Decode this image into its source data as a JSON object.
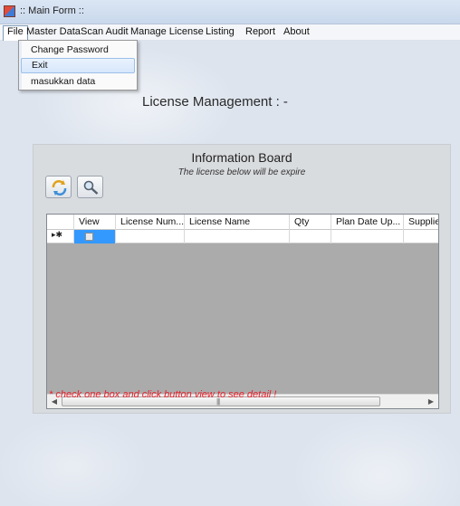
{
  "window": {
    "title": ":: Main Form ::"
  },
  "menu": [
    "File",
    "Master Data",
    "Scan Audit",
    "Manage License",
    "Listing",
    "Report",
    "About"
  ],
  "file_menu": {
    "items": [
      "Change Password",
      "Exit",
      "masukkan data"
    ],
    "highlighted": "Exit"
  },
  "main": {
    "heading": "License Management :  -"
  },
  "board": {
    "title": "Information Board",
    "subtitle": "The license below will be expire",
    "refresh_icon": "refresh-icon",
    "search_icon": "search-icon",
    "columns": [
      "View",
      "License Num...",
      "License Name",
      "Qty",
      "Plan Date Up...",
      "Supplie"
    ],
    "new_row_marker": "▸✱",
    "note": "* check one box and click button view to see detail !"
  },
  "colors": {
    "accent_selection": "#3399ff",
    "note_red": "#e8202a",
    "grid_empty": "#ababab"
  }
}
